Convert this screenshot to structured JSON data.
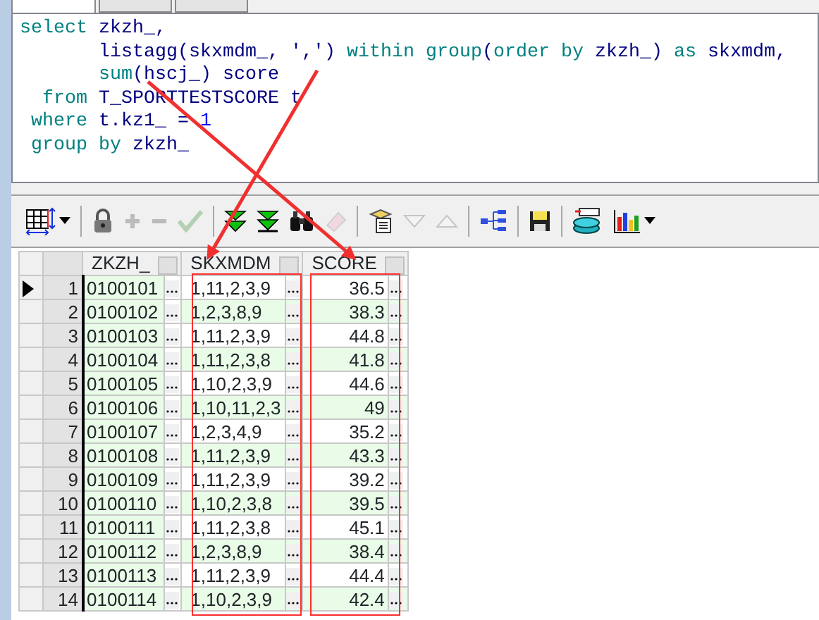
{
  "tabs": [
    {
      "selected": true
    },
    {
      "selected": false
    },
    {
      "selected": false
    }
  ],
  "editor": {
    "lines": [
      [
        {
          "kind": "keyword",
          "text": "select"
        },
        {
          "kind": "ident",
          "text": " zkzh_,"
        }
      ],
      [
        {
          "kind": "ident",
          "text": "       listagg(skxmdm_, "
        },
        {
          "kind": "string",
          "text": "','"
        },
        {
          "kind": "ident",
          "text": ") "
        },
        {
          "kind": "keyword",
          "text": "within group"
        },
        {
          "kind": "ident",
          "text": "("
        },
        {
          "kind": "keyword",
          "text": "order by"
        },
        {
          "kind": "ident",
          "text": " zkzh_) "
        },
        {
          "kind": "keyword",
          "text": "as"
        },
        {
          "kind": "ident",
          "text": " skxmdm,"
        }
      ],
      [
        {
          "kind": "keyword",
          "text": "       sum"
        },
        {
          "kind": "ident",
          "text": "(hscj_) score"
        }
      ],
      [
        {
          "kind": "keyword",
          "text": "  from"
        },
        {
          "kind": "ident",
          "text": " T_SPORTTESTSCORE t"
        }
      ],
      [
        {
          "kind": "keyword",
          "text": " where"
        },
        {
          "kind": "ident",
          "text": " t.kz1_ = "
        },
        {
          "kind": "number",
          "text": "1"
        }
      ],
      [
        {
          "kind": "keyword",
          "text": " group by"
        },
        {
          "kind": "ident",
          "text": " zkzh_"
        }
      ]
    ]
  },
  "toolbar": [
    {
      "kind": "grid",
      "disabled": false,
      "dropdown": true
    },
    {
      "kind": "separator"
    },
    {
      "kind": "lock",
      "disabled": false
    },
    {
      "kind": "plus",
      "disabled": true
    },
    {
      "kind": "minus",
      "disabled": true
    },
    {
      "kind": "check",
      "disabled": true
    },
    {
      "kind": "separator"
    },
    {
      "kind": "fetch-next",
      "disabled": false
    },
    {
      "kind": "fetch-last",
      "disabled": false
    },
    {
      "kind": "find",
      "disabled": false
    },
    {
      "kind": "clear",
      "disabled": true
    },
    {
      "kind": "separator"
    },
    {
      "kind": "clipboard",
      "disabled": false
    },
    {
      "kind": "down",
      "disabled": true
    },
    {
      "kind": "up",
      "disabled": true
    },
    {
      "kind": "separator"
    },
    {
      "kind": "tree",
      "disabled": false
    },
    {
      "kind": "separator"
    },
    {
      "kind": "save",
      "disabled": false
    },
    {
      "kind": "separator"
    },
    {
      "kind": "database",
      "disabled": false
    },
    {
      "kind": "chart",
      "disabled": false,
      "dropdown": true
    }
  ],
  "grid": {
    "columns": [
      {
        "label": "ZKZH_",
        "kind": "text",
        "highlighted": false
      },
      {
        "label": "SKXMDM",
        "kind": "text",
        "highlighted": true
      },
      {
        "label": "SCORE",
        "kind": "number",
        "highlighted": true
      }
    ],
    "rows": [
      {
        "number": "1",
        "current": true,
        "cells": [
          "0100101",
          "1,11,2,3,9",
          "36.5"
        ]
      },
      {
        "number": "2",
        "current": false,
        "cells": [
          "0100102",
          "1,2,3,8,9",
          "38.3"
        ]
      },
      {
        "number": "3",
        "current": false,
        "cells": [
          "0100103",
          "1,11,2,3,9",
          "44.8"
        ]
      },
      {
        "number": "4",
        "current": false,
        "cells": [
          "0100104",
          "1,11,2,3,8",
          "41.8"
        ]
      },
      {
        "number": "5",
        "current": false,
        "cells": [
          "0100105",
          "1,10,2,3,9",
          "44.6"
        ]
      },
      {
        "number": "6",
        "current": false,
        "cells": [
          "0100106",
          "1,10,11,2,3",
          "49"
        ]
      },
      {
        "number": "7",
        "current": false,
        "cells": [
          "0100107",
          "1,2,3,4,9",
          "35.2"
        ]
      },
      {
        "number": "8",
        "current": false,
        "cells": [
          "0100108",
          "1,11,2,3,9",
          "43.3"
        ]
      },
      {
        "number": "9",
        "current": false,
        "cells": [
          "0100109",
          "1,11,2,3,9",
          "39.2"
        ]
      },
      {
        "number": "10",
        "current": false,
        "cells": [
          "0100110",
          "1,10,2,3,8",
          "39.5"
        ]
      },
      {
        "number": "11",
        "current": false,
        "cells": [
          "0100111",
          "1,11,2,3,8",
          "45.1"
        ]
      },
      {
        "number": "12",
        "current": false,
        "cells": [
          "0100112",
          "1,2,3,8,9",
          "38.4"
        ]
      },
      {
        "number": "13",
        "current": false,
        "cells": [
          "0100113",
          "1,11,2,3,9",
          "44.4"
        ]
      },
      {
        "number": "14",
        "current": false,
        "cells": [
          "0100114",
          "1,10,2,3,9",
          "42.4"
        ]
      }
    ]
  }
}
